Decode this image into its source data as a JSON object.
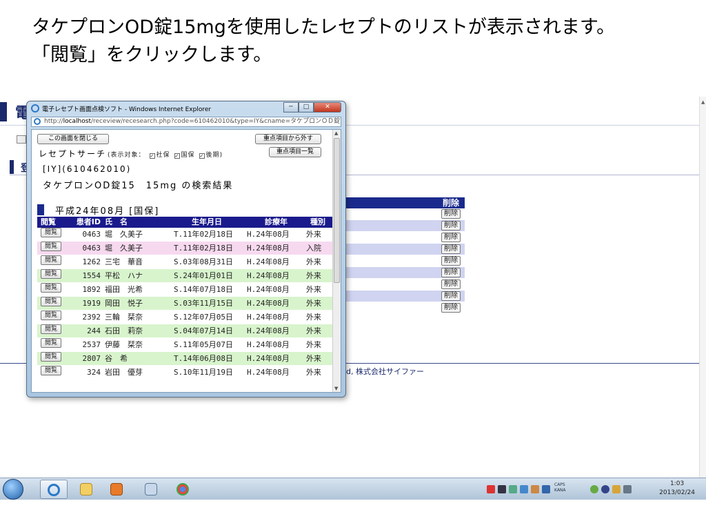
{
  "slide": {
    "line1": "タケプロンOD錠15mgを使用したレセプトのリストが表示されます。",
    "line2": "「閲覧」をクリックします。"
  },
  "background_page": {
    "header_glyph": "電",
    "band_glyph": "登",
    "table_header": "削除",
    "delete_label": "削除",
    "footer_text": "株式会社サイファー",
    "footer_prefix": "d,"
  },
  "window": {
    "title": "電子レセプト画面点検ソフト - Windows Internet Explorer",
    "url_prefix": "http://",
    "url_host": "localhost",
    "url_rest": "/receview/recesearch.php?code=610462010&type=IY&cname=タケプロンＯＤ錠1",
    "minimize": "─",
    "maximize": "□",
    "close": "✕"
  },
  "content": {
    "close_page_button": "この画面を閉じる",
    "remove_button": "重点項目から外す",
    "list_button": "重点項目一覧",
    "search_title": "レセプトサーチ",
    "filter_label": "(表示対象：",
    "filters": [
      "社保",
      "国保",
      "後期"
    ],
    "filter_close": ")",
    "code_line": "[IY](610462010)",
    "result_line": "タケプロンOD錠15　15mg の検索結果",
    "month_head": "平成24年08月 [国保]"
  },
  "table": {
    "headers": {
      "view": "閲覧",
      "id": "患者ID",
      "name": "氏　名",
      "birth": "生年月日",
      "month": "診療年",
      "type": "種別"
    },
    "view_label": "閲覧",
    "rows": [
      {
        "id": "0463",
        "name": "堀　久美子",
        "birth": "T.11年02月18日",
        "month": "H.24年08月",
        "type": "外来"
      },
      {
        "id": "0463",
        "name": "堀　久美子",
        "birth": "T.11年02月18日",
        "month": "H.24年08月",
        "type": "入院"
      },
      {
        "id": "1262",
        "name": "三宅　華音",
        "birth": "S.03年08月31日",
        "month": "H.24年08月",
        "type": "外来"
      },
      {
        "id": "1554",
        "name": "平松　ハナ",
        "birth": "S.24年01月01日",
        "month": "H.24年08月",
        "type": "外来"
      },
      {
        "id": "1892",
        "name": "福田　光希",
        "birth": "S.14年07月18日",
        "month": "H.24年08月",
        "type": "外来"
      },
      {
        "id": "1919",
        "name": "岡田　悦子",
        "birth": "S.03年11月15日",
        "month": "H.24年08月",
        "type": "外来"
      },
      {
        "id": "2392",
        "name": "三輪　栞奈",
        "birth": "S.12年07月05日",
        "month": "H.24年08月",
        "type": "外来"
      },
      {
        "id": "244",
        "name": "石田　莉奈",
        "birth": "S.04年07月14日",
        "month": "H.24年08月",
        "type": "外来"
      },
      {
        "id": "2537",
        "name": "伊藤　栞奈",
        "birth": "S.11年05月07日",
        "month": "H.24年08月",
        "type": "外来"
      },
      {
        "id": "2807",
        "name": "谷　希",
        "birth": "T.14年06月08日",
        "month": "H.24年08月",
        "type": "外来"
      },
      {
        "id": "324",
        "name": "岩田　優芽",
        "birth": "S.10年11月19日",
        "month": "H.24年08月",
        "type": "外来"
      }
    ]
  },
  "taskbar": {
    "time": "1:03",
    "date": "2013/02/24",
    "caps": "CAPS",
    "kana": "KANA"
  }
}
